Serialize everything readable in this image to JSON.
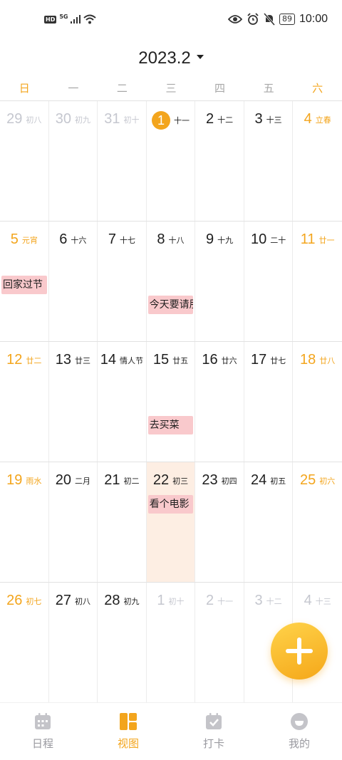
{
  "status_bar": {
    "hd": "HD",
    "network": "5G",
    "battery": "89",
    "time": "10:00"
  },
  "header": {
    "month": "2023.2"
  },
  "weekdays": [
    {
      "label": "日",
      "weekend": true
    },
    {
      "label": "一",
      "weekend": false
    },
    {
      "label": "二",
      "weekend": false
    },
    {
      "label": "三",
      "weekend": false
    },
    {
      "label": "四",
      "weekend": false
    },
    {
      "label": "五",
      "weekend": false
    },
    {
      "label": "六",
      "weekend": true
    }
  ],
  "weeks": [
    [
      {
        "day": "29",
        "lunar": "初八",
        "other": true
      },
      {
        "day": "30",
        "lunar": "初九",
        "other": true
      },
      {
        "day": "31",
        "lunar": "初十",
        "other": true
      },
      {
        "day": "1",
        "lunar": "十一",
        "today": true
      },
      {
        "day": "2",
        "lunar": "十二"
      },
      {
        "day": "3",
        "lunar": "十三"
      },
      {
        "day": "4",
        "lunar": "立春",
        "weekend": true
      }
    ],
    [
      {
        "day": "5",
        "lunar": "元宵",
        "weekend": true,
        "event": {
          "title": "回家过节",
          "row": 1
        }
      },
      {
        "day": "6",
        "lunar": "十六"
      },
      {
        "day": "7",
        "lunar": "十七"
      },
      {
        "day": "8",
        "lunar": "十八",
        "event": {
          "title": "今天要请朋友吃饭",
          "row": 2
        }
      },
      {
        "day": "9",
        "lunar": "十九"
      },
      {
        "day": "10",
        "lunar": "二十"
      },
      {
        "day": "11",
        "lunar": "廿一",
        "weekend": true
      }
    ],
    [
      {
        "day": "12",
        "lunar": "廿二",
        "weekend": true
      },
      {
        "day": "13",
        "lunar": "廿三"
      },
      {
        "day": "14",
        "lunar": "情人节"
      },
      {
        "day": "15",
        "lunar": "廿五",
        "event": {
          "title": "去买菜",
          "row": 2
        }
      },
      {
        "day": "16",
        "lunar": "廿六"
      },
      {
        "day": "17",
        "lunar": "廿七"
      },
      {
        "day": "18",
        "lunar": "廿八",
        "weekend": true
      }
    ],
    [
      {
        "day": "19",
        "lunar": "雨水",
        "weekend": true
      },
      {
        "day": "20",
        "lunar": "二月"
      },
      {
        "day": "21",
        "lunar": "初二"
      },
      {
        "day": "22",
        "lunar": "初三",
        "selected": true,
        "event": {
          "title": "看个电影",
          "row": 1
        }
      },
      {
        "day": "23",
        "lunar": "初四"
      },
      {
        "day": "24",
        "lunar": "初五"
      },
      {
        "day": "25",
        "lunar": "初六",
        "weekend": true
      }
    ],
    [
      {
        "day": "26",
        "lunar": "初七",
        "weekend": true
      },
      {
        "day": "27",
        "lunar": "初八"
      },
      {
        "day": "28",
        "lunar": "初九"
      },
      {
        "day": "1",
        "lunar": "初十",
        "other": true
      },
      {
        "day": "2",
        "lunar": "十一",
        "other": true
      },
      {
        "day": "3",
        "lunar": "十二",
        "other": true
      },
      {
        "day": "4",
        "lunar": "十三",
        "other": true
      }
    ]
  ],
  "bottom_nav": [
    {
      "label": "日程",
      "icon": "calendar-icon",
      "active": false
    },
    {
      "label": "视图",
      "icon": "grid-view-icon",
      "active": true
    },
    {
      "label": "打卡",
      "icon": "checkin-icon",
      "active": false
    },
    {
      "label": "我的",
      "icon": "profile-icon",
      "active": false
    }
  ],
  "colors": {
    "accent": "#f3a51d",
    "event_bg": "#f9c9cc",
    "selected_bg": "#fdeee3",
    "muted": "#c5c7cf"
  }
}
